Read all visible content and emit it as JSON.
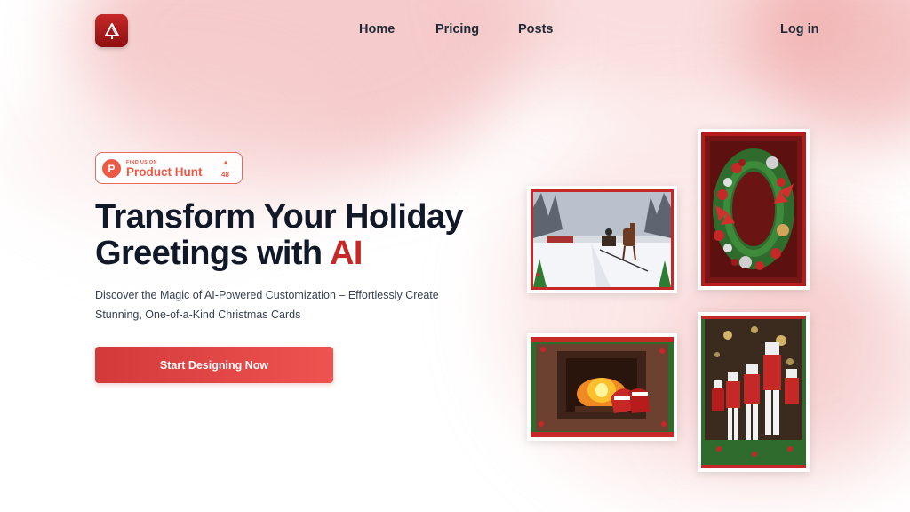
{
  "nav": {
    "logo_icon": "christmas-tree-icon",
    "links": [
      "Home",
      "Pricing",
      "Posts"
    ],
    "login": "Log in"
  },
  "badge": {
    "icon": "P",
    "small_text": "FIND US ON",
    "name": "Product Hunt",
    "upvote_icon": "▲",
    "count": "48"
  },
  "hero": {
    "headline_part1": "Transform Your Holiday Greetings with ",
    "headline_accent": "AI",
    "subtext": "Discover the Magic of AI-Powered Customization – Effortlessly Create Stunning, One-of-a-Kind Christmas Cards",
    "cta": "Start Designing Now"
  },
  "gallery": {
    "cards": [
      "horse-sleigh-snow-card",
      "christmas-wreath-card",
      "fireplace-stockings-card",
      "nutcracker-soldiers-card"
    ]
  },
  "colors": {
    "accent": "#c62828",
    "cta_start": "#d23a3a",
    "cta_end": "#ef5350",
    "product_hunt": "#ea5a47"
  }
}
